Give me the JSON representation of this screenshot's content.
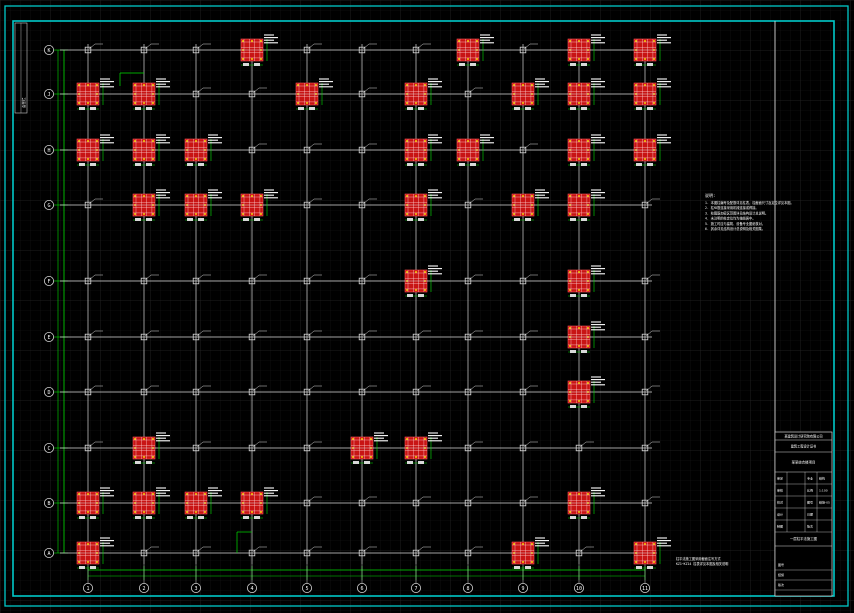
{
  "colors": {
    "background": "#000000",
    "grid_bg": "#1c1c1c",
    "frame": "#00c8c8",
    "axis_line": "#d8d8d8",
    "dimension": "#00e000",
    "column_fill": "#c81414",
    "column_rebar": "#ffff00",
    "label": "#ffffff",
    "titleblock_line": "#d8d8d8"
  },
  "axes": {
    "x_labels": [
      "1",
      "2",
      "3",
      "4",
      "5",
      "6",
      "7",
      "8",
      "9",
      "10",
      "11"
    ],
    "y_labels": [
      "K",
      "J",
      "H",
      "G",
      "F",
      "E",
      "D",
      "C",
      "B",
      "A"
    ]
  },
  "big_columns": [
    [
      3,
      0
    ],
    [
      7,
      0
    ],
    [
      9,
      0
    ],
    [
      10,
      0
    ],
    [
      0,
      1
    ],
    [
      1,
      1
    ],
    [
      4,
      1
    ],
    [
      6,
      1
    ],
    [
      8,
      1
    ],
    [
      9,
      1
    ],
    [
      10,
      1
    ],
    [
      0,
      2
    ],
    [
      1,
      2
    ],
    [
      2,
      2
    ],
    [
      6,
      2
    ],
    [
      7,
      2
    ],
    [
      9,
      2
    ],
    [
      10,
      2
    ],
    [
      1,
      3
    ],
    [
      2,
      3
    ],
    [
      3,
      3
    ],
    [
      6,
      3
    ],
    [
      8,
      3
    ],
    [
      9,
      3
    ],
    [
      6,
      4
    ],
    [
      9,
      4
    ],
    [
      9,
      5
    ],
    [
      9,
      6
    ],
    [
      1,
      7
    ],
    [
      5,
      7
    ],
    [
      6,
      7
    ],
    [
      0,
      8
    ],
    [
      1,
      8
    ],
    [
      2,
      8
    ],
    [
      3,
      8
    ],
    [
      9,
      8
    ],
    [
      0,
      9
    ],
    [
      8,
      9
    ],
    [
      10,
      9
    ]
  ],
  "notes": {
    "heading": "说明:",
    "lines": [
      "1. 本图柱编号及配筋详见柱表，柱截面尺寸及定位详见本图。",
      "2. 柱纵筋连接采用机械连接或焊接。",
      "3. 柱箍筋加密区范围详见结构设计总说明。",
      "4. 未注明的柱定位均为轴线居中。",
      "5. 施工时应与建筑、设备专业图纸核对。",
      "6. 其余详见结构设计总说明及相关图集。"
    ]
  },
  "bottom_note": {
    "lines": [
      "柱平法施工图采用截面注写方式",
      "KZ1~KZ14 柱表详见本图及相关说明"
    ]
  },
  "title_block": {
    "company": "某建筑设计研究院有限公司",
    "cert": "建筑工程设计证书",
    "project": "某某综合楼项目",
    "drawing_title": "一层柱平法施工图",
    "rows": [
      {
        "k": "审定",
        "v": "",
        "k2": "专业",
        "v2": "结构"
      },
      {
        "k": "审核",
        "v": "",
        "k2": "比例",
        "v2": "1:100"
      },
      {
        "k": "校对",
        "v": "",
        "k2": "图号",
        "v2": "结施-05"
      },
      {
        "k": "设计",
        "v": "",
        "k2": "日期",
        "v2": ""
      },
      {
        "k": "制图",
        "v": "",
        "k2": "版次",
        "v2": ""
      }
    ],
    "footer": [
      "图号",
      "结施",
      "版次"
    ]
  },
  "margin_strip": "会签栏"
}
